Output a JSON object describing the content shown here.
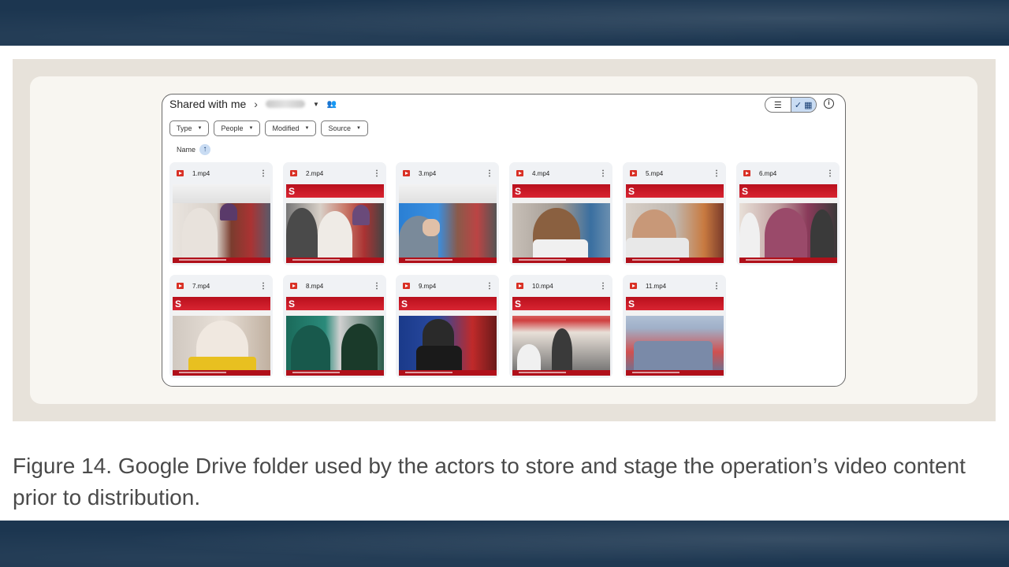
{
  "drive": {
    "breadcrumb_root": "Shared with me",
    "filters": [
      "Type",
      "People",
      "Modified",
      "Source"
    ],
    "sort_label": "Name",
    "files": [
      {
        "name": "1.mp4"
      },
      {
        "name": "2.mp4"
      },
      {
        "name": "3.mp4"
      },
      {
        "name": "4.mp4"
      },
      {
        "name": "5.mp4"
      },
      {
        "name": "6.mp4"
      },
      {
        "name": "7.mp4"
      },
      {
        "name": "8.mp4"
      },
      {
        "name": "9.mp4"
      },
      {
        "name": "10.mp4"
      },
      {
        "name": "11.mp4"
      }
    ]
  },
  "caption": "Figure 14. Google Drive folder used by the actors to store and stage the operation’s video content prior to distribution.",
  "colors": {
    "accent": "#d93025",
    "band": "#1c3650",
    "selected": "#c9dcf3"
  },
  "icons": [
    "chevron-right-icon",
    "people-icon",
    "list-view-icon",
    "grid-view-icon",
    "info-icon",
    "sort-up-icon",
    "video-file-icon",
    "more-vert-icon"
  ]
}
